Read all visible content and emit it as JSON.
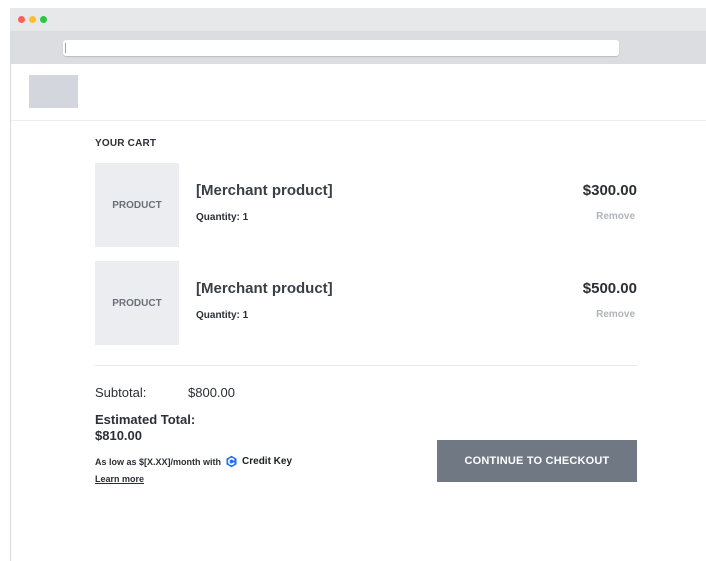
{
  "cart": {
    "title": "YOUR CART",
    "items": [
      {
        "thumb_label": "PRODUCT",
        "name": "[Merchant product]",
        "quantity": "Quantity: 1",
        "price": "$300.00",
        "remove_label": "Remove"
      },
      {
        "thumb_label": "PRODUCT",
        "name": "[Merchant product]",
        "quantity": "Quantity: 1",
        "price": "$500.00",
        "remove_label": "Remove"
      }
    ]
  },
  "summary": {
    "subtotal_label": "Subtotal:",
    "subtotal_value": "$800.00",
    "estimated_label": "Estimated Total:",
    "estimated_value": "$810.00",
    "as_low_as": "As low as $[X.XX]/month with",
    "credit_key": "Credit Key",
    "learn_more": "Learn more",
    "checkout_button": "CONTINUE TO CHECKOUT"
  },
  "colors": {
    "credit_key_brand": "#1f6df2",
    "checkout_button": "#707983"
  },
  "icons": {
    "credit_key_logo": "credit-key-logo-icon"
  }
}
